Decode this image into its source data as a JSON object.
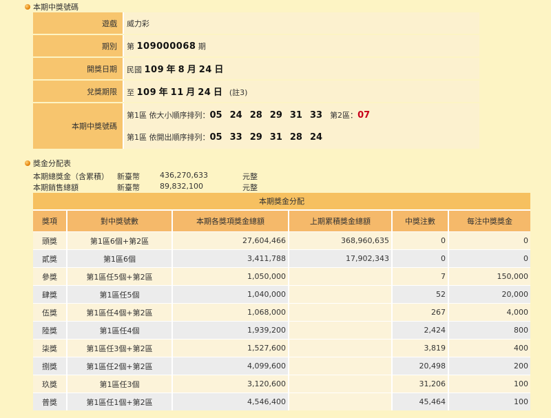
{
  "section1": {
    "title": "本期中獎號碼"
  },
  "info": {
    "game_label": "遊戲",
    "game_value": "威力彩",
    "period_label": "期別",
    "period_prefix": "第",
    "period_number": "109000068",
    "period_suffix": "期",
    "draw_date_label": "開獎日期",
    "draw_date": {
      "prefix": "民國",
      "year": "109",
      "year_unit": "年",
      "month": "8",
      "month_unit": "月",
      "day": "24",
      "day_unit": "日"
    },
    "claim_label": "兌獎期限",
    "claim_date": {
      "prefix": "至",
      "year": "109",
      "year_unit": "年",
      "month": "11",
      "month_unit": "月",
      "day": "24",
      "day_unit": "日",
      "note": "(註3)"
    },
    "winning_label": "本期中獎號碼",
    "sorted_label": "第1區 依大小順序排列：",
    "sorted_numbers": [
      "05",
      "24",
      "28",
      "29",
      "31",
      "33"
    ],
    "zone2_label": "第2區：",
    "zone2_number": "07",
    "drawn_label": "第1區 依開出順序排列：",
    "drawn_numbers": [
      "05",
      "33",
      "29",
      "31",
      "28",
      "24"
    ]
  },
  "section2": {
    "title": "獎金分配表"
  },
  "summary": {
    "total_label": "本期總獎金（含累積）",
    "total_currency": "新臺幣",
    "total_amount": "436,270,633",
    "total_unit": "元整",
    "sales_label": "本期銷售總額",
    "sales_currency": "新臺幣",
    "sales_amount": "89,832,100",
    "sales_unit": "元整"
  },
  "prize_table": {
    "caption": "本期獎金分配",
    "headers": [
      "獎項",
      "對中獎號數",
      "本期各獎項獎金總額",
      "上期累積獎金總額",
      "中獎注數",
      "每注中獎獎金"
    ],
    "rows": [
      [
        "頭獎",
        "第1區6個+第2區",
        "27,604,466",
        "368,960,635",
        "0",
        "0"
      ],
      [
        "貳獎",
        "第1區6個",
        "3,411,788",
        "17,902,343",
        "0",
        "0"
      ],
      [
        "參獎",
        "第1區任5個+第2區",
        "1,050,000",
        "",
        "7",
        "150,000"
      ],
      [
        "肆獎",
        "第1區任5個",
        "1,040,000",
        "",
        "52",
        "20,000"
      ],
      [
        "伍獎",
        "第1區任4個+第2區",
        "1,068,000",
        "",
        "267",
        "4,000"
      ],
      [
        "陸獎",
        "第1區任4個",
        "1,939,200",
        "",
        "2,424",
        "800"
      ],
      [
        "柒獎",
        "第1區任3個+第2區",
        "1,527,600",
        "",
        "3,819",
        "400"
      ],
      [
        "捌獎",
        "第1區任2個+第2區",
        "4,099,600",
        "",
        "20,498",
        "200"
      ],
      [
        "玖獎",
        "第1區任3個",
        "3,120,600",
        "",
        "31,206",
        "100"
      ],
      [
        "普獎",
        "第1區任1個+第2區",
        "4,546,400",
        "",
        "45,464",
        "100"
      ]
    ]
  }
}
